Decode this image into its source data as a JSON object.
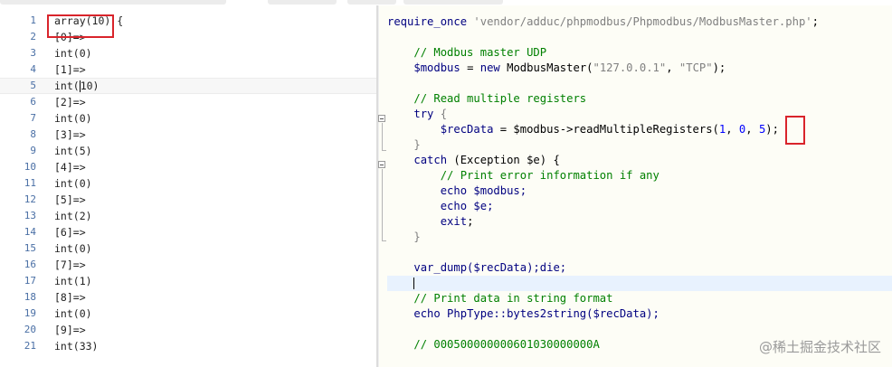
{
  "left_pane": {
    "lines": [
      {
        "num": "1",
        "text": "array(10) {"
      },
      {
        "num": "2",
        "text": "[0]=>"
      },
      {
        "num": "3",
        "text": "int(0)"
      },
      {
        "num": "4",
        "text": "[1]=>"
      },
      {
        "num": "5",
        "text": "int(10)",
        "current": true
      },
      {
        "num": "6",
        "text": "[2]=>"
      },
      {
        "num": "7",
        "text": "int(0)"
      },
      {
        "num": "8",
        "text": "[3]=>"
      },
      {
        "num": "9",
        "text": "int(5)"
      },
      {
        "num": "10",
        "text": "[4]=>"
      },
      {
        "num": "11",
        "text": "int(0)"
      },
      {
        "num": "12",
        "text": "[5]=>"
      },
      {
        "num": "13",
        "text": "int(2)"
      },
      {
        "num": "14",
        "text": "[6]=>"
      },
      {
        "num": "15",
        "text": "int(0)"
      },
      {
        "num": "16",
        "text": "[7]=>"
      },
      {
        "num": "17",
        "text": "int(1)"
      },
      {
        "num": "18",
        "text": "[8]=>"
      },
      {
        "num": "19",
        "text": "int(0)"
      },
      {
        "num": "20",
        "text": "[9]=>"
      },
      {
        "num": "21",
        "text": "int(33)"
      }
    ]
  },
  "right_pane": {
    "require_kw": "require_once",
    "require_path": "'vendor/adduc/phpmodbus/Phpmodbus/ModbusMaster.php'",
    "require_end": ";",
    "comment_udp": "// Modbus master UDP",
    "modbus_var": "$modbus",
    "assign": " = ",
    "new_kw": "new",
    "class_name": " ModbusMaster(",
    "ip_str": "\"127.0.0.1\"",
    "comma": ", ",
    "tcp_str": "\"TCP\"",
    "close_paren": ");",
    "comment_read": "// Read multiple registers",
    "try_kw": "try",
    "open_brace": " {",
    "recdata_var": "$recData",
    "arrow_call": " = $modbus->readMultipleRegisters(",
    "arg1": "1",
    "arg2": "0",
    "arg3": "5",
    "call_end": ");",
    "close_brace": "}",
    "catch_kw": "catch",
    "catch_args": " (Exception $e) {",
    "comment_print": "// Print error information if any",
    "echo_kw": "echo",
    "echo_modbus": " $modbus;",
    "echo_e": " $e;",
    "exit_kw": "exit",
    "exit_end": ";",
    "var_dump": "var_dump($recData);die;",
    "comment_string": "// Print data in string format",
    "echo_bytes": " PhpType::bytes2string($recData);",
    "comment_hex": "// 000500000000601030000000A"
  },
  "watermark": "@稀土掘金技术社区"
}
